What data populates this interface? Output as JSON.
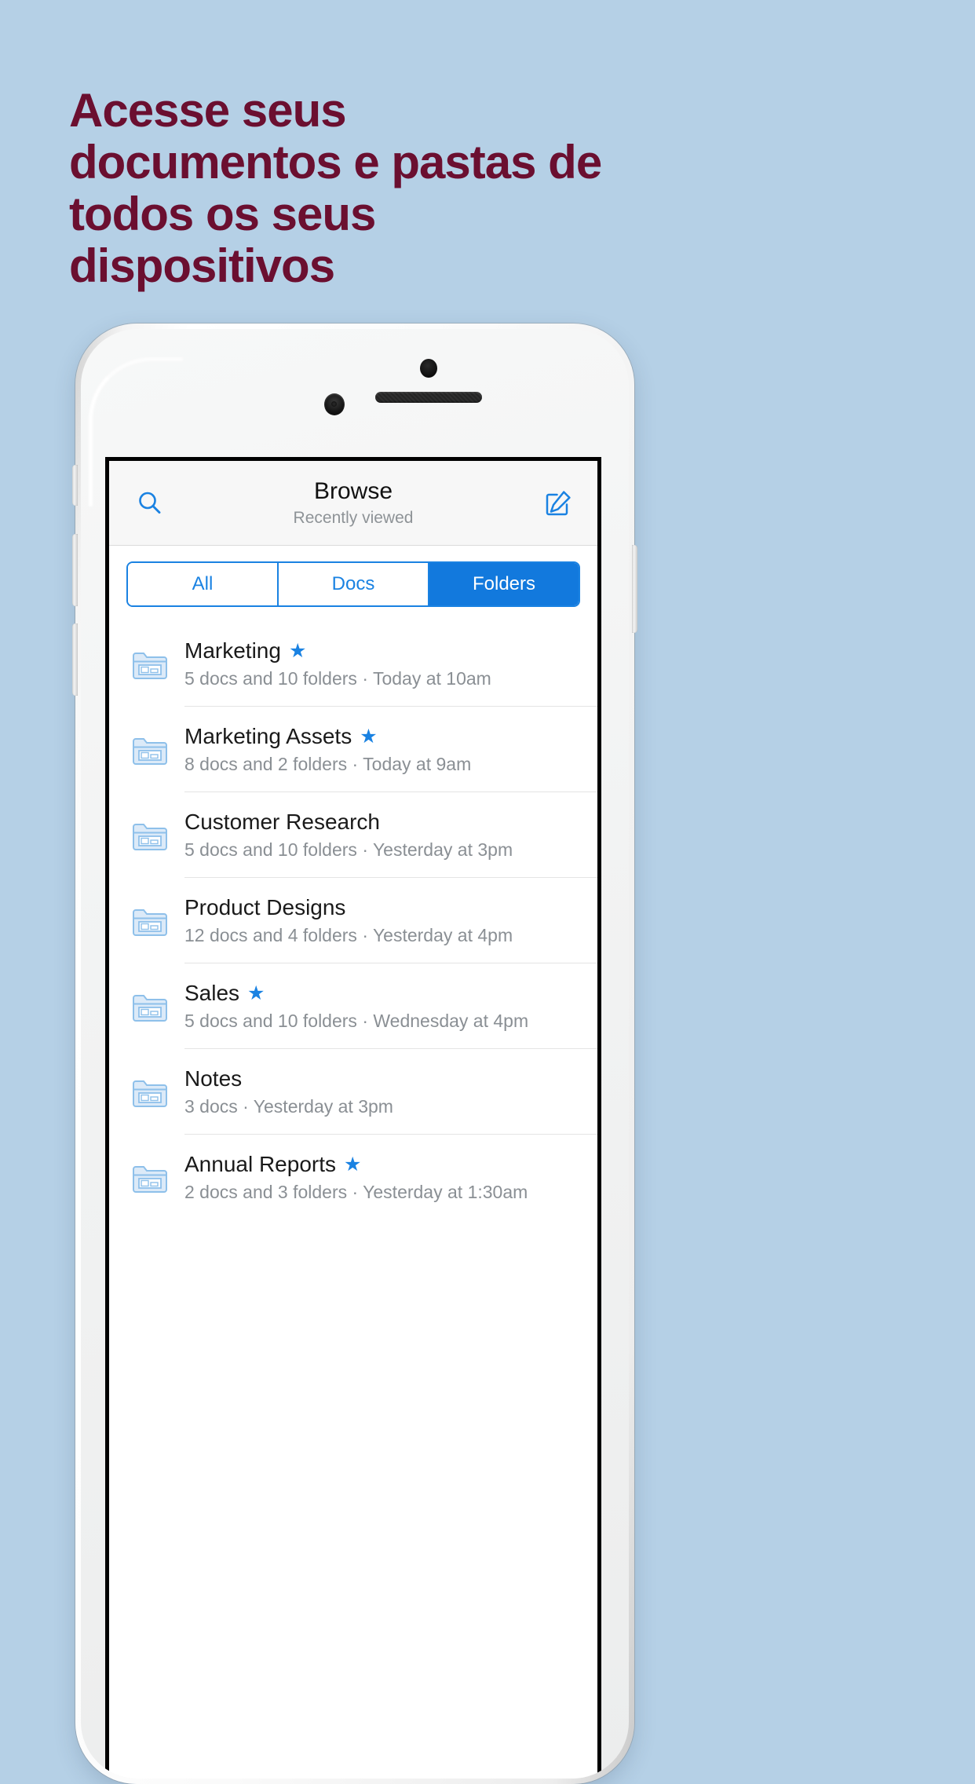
{
  "headline": "Acesse seus documentos e pastas de todos os seus dispositivos",
  "colors": {
    "background": "#b5d0e6",
    "headline": "#6b0f30",
    "accent": "#1a82e2",
    "accent_fill": "#1279dd",
    "folder_icon": "#a9cff0",
    "subtitle_text": "#8a8f94"
  },
  "app": {
    "navbar": {
      "title": "Browse",
      "subtitle": "Recently viewed",
      "search_icon": "search-icon",
      "compose_icon": "compose-icon"
    },
    "segmented_control": {
      "options": [
        {
          "label": "All",
          "active": false
        },
        {
          "label": "Docs",
          "active": false
        },
        {
          "label": "Folders",
          "active": true
        }
      ]
    },
    "list": {
      "items": [
        {
          "icon": "folder-icon",
          "title": "Marketing",
          "starred": true,
          "star_glyph": "★",
          "subtitle": "5 docs and 10 folders · Today at 10am"
        },
        {
          "icon": "folder-icon",
          "title": "Marketing Assets",
          "starred": true,
          "star_glyph": "★",
          "subtitle": "8 docs and 2 folders · Today at 9am"
        },
        {
          "icon": "folder-icon",
          "title": "Customer Research",
          "starred": false,
          "star_glyph": "",
          "subtitle": "5 docs and 10 folders · Yesterday at 3pm"
        },
        {
          "icon": "folder-icon",
          "title": "Product Designs",
          "starred": false,
          "star_glyph": "",
          "subtitle": "12 docs and 4 folders · Yesterday at 4pm"
        },
        {
          "icon": "folder-icon",
          "title": "Sales",
          "starred": true,
          "star_glyph": "★",
          "subtitle": "5 docs and 10 folders · Wednesday at 4pm"
        },
        {
          "icon": "folder-icon",
          "title": "Notes",
          "starred": false,
          "star_glyph": "",
          "subtitle": "3 docs · Yesterday at 3pm"
        },
        {
          "icon": "folder-icon",
          "title": "Annual Reports",
          "starred": true,
          "star_glyph": "★",
          "subtitle": "2 docs and 3 folders · Yesterday at 1:30am"
        }
      ]
    }
  },
  "device": {
    "camera_icon": "front-camera-icon",
    "sensor_icon": "proximity-sensor-icon",
    "speaker_icon": "earpiece-speaker-icon"
  }
}
